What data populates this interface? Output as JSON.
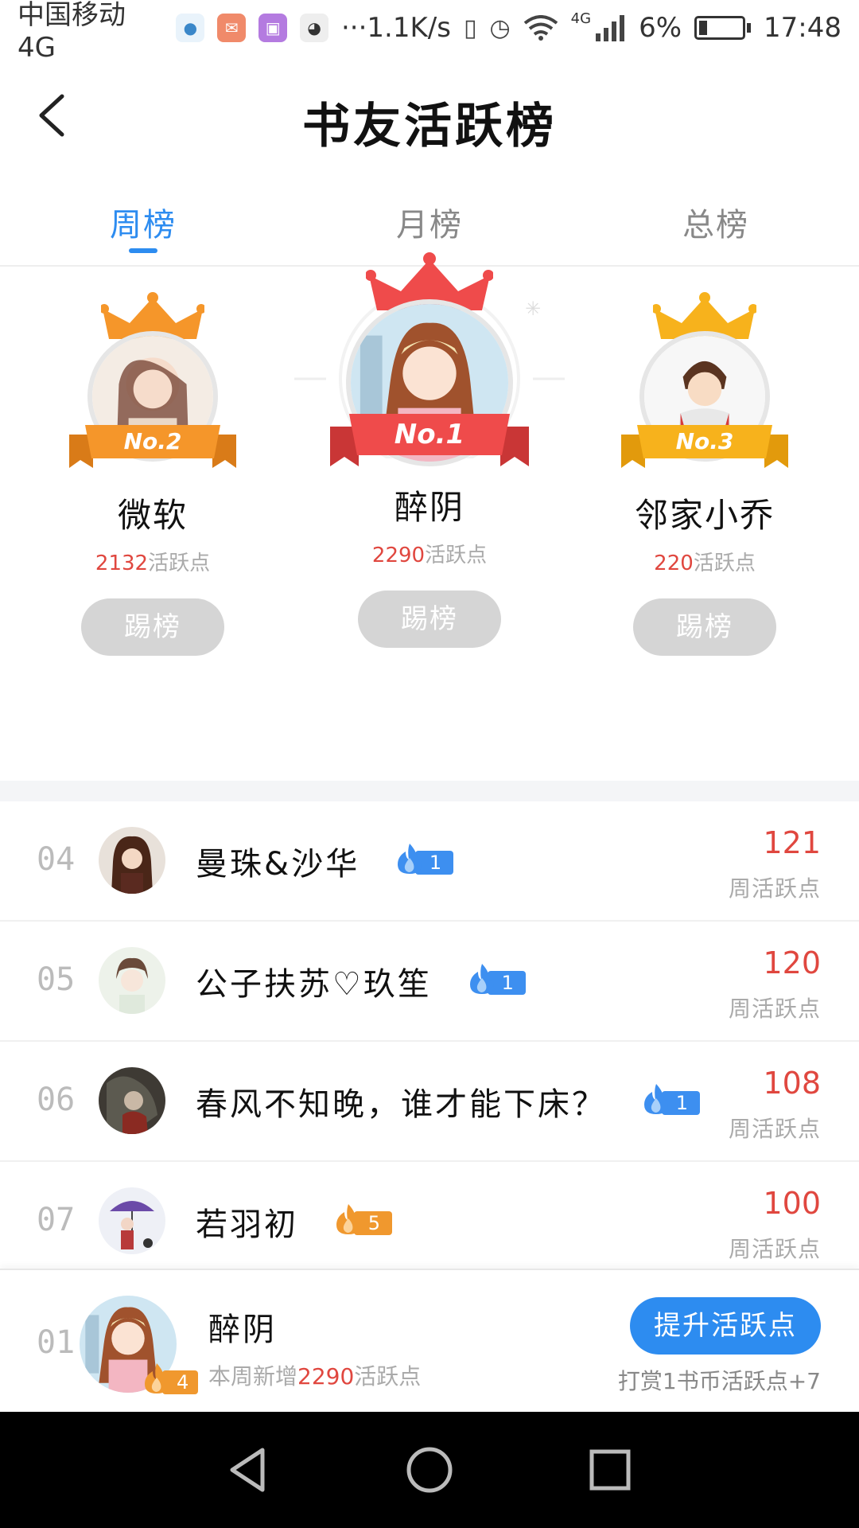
{
  "status_bar": {
    "carrier": "中国移动4G",
    "more": "···",
    "speed": "1.1K/s",
    "network": "4G",
    "battery": "6%",
    "time": "17:48"
  },
  "header": {
    "title": "书友活跃榜"
  },
  "tabs": [
    {
      "label": "周榜",
      "active": true
    },
    {
      "label": "月榜",
      "active": false
    },
    {
      "label": "总榜",
      "active": false
    }
  ],
  "podium": [
    {
      "rank_label": "No.2",
      "name": "微软",
      "points": "2132",
      "points_unit": "活跃点",
      "button": "踢榜",
      "color": "#f5962a"
    },
    {
      "rank_label": "No.1",
      "name": "醉阴",
      "points": "2290",
      "points_unit": "活跃点",
      "button": "踢榜",
      "color": "#ef4b4b"
    },
    {
      "rank_label": "No.3",
      "name": "邻家小乔",
      "points": "220",
      "points_unit": "活跃点",
      "button": "踢榜",
      "color": "#f7b21c"
    }
  ],
  "list": [
    {
      "rank": "04",
      "name": "曼珠&沙华",
      "level": "1",
      "badge": "blue",
      "score": "121",
      "score_label": "周活跃点"
    },
    {
      "rank": "05",
      "name": "公子扶苏♡玖笙",
      "level": "1",
      "badge": "blue",
      "score": "120",
      "score_label": "周活跃点"
    },
    {
      "rank": "06",
      "name": "春风不知晚，谁才能下床？",
      "level": "1",
      "badge": "blue",
      "score": "108",
      "score_label": "周活跃点"
    },
    {
      "rank": "07",
      "name": "若羽初",
      "level": "5",
      "badge": "orange",
      "score": "100",
      "score_label": "周活跃点"
    }
  ],
  "me": {
    "rank": "01",
    "name": "醉阴",
    "level": "4",
    "sub_prefix": "本周新增",
    "sub_points": "2290",
    "sub_suffix": "活跃点",
    "button": "提升活跃点",
    "reward_note": "打赏1书币活跃点+7"
  },
  "colors": {
    "accent": "#2d8cf0",
    "score": "#e0473f"
  }
}
